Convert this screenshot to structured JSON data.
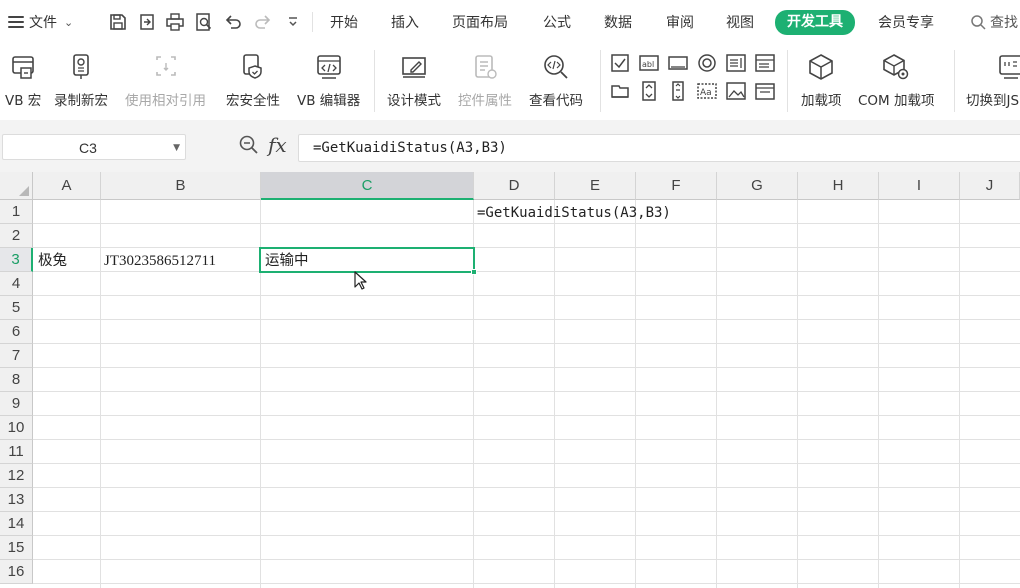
{
  "menubar": {
    "file_label": "文件",
    "tabs": [
      {
        "label": "开始",
        "active": false
      },
      {
        "label": "插入",
        "active": false
      },
      {
        "label": "页面布局",
        "active": false
      },
      {
        "label": "公式",
        "active": false
      },
      {
        "label": "数据",
        "active": false
      },
      {
        "label": "审阅",
        "active": false
      },
      {
        "label": "视图",
        "active": false
      },
      {
        "label": "开发工具",
        "active": true
      },
      {
        "label": "会员专享",
        "active": false
      }
    ],
    "search_label": "查找"
  },
  "ribbon": {
    "buttons": [
      {
        "label": "VB 宏",
        "icon": "vb-macro-icon",
        "enabled": true
      },
      {
        "label": "录制新宏",
        "icon": "record-macro-icon",
        "enabled": true
      },
      {
        "label": "使用相对引用",
        "icon": "relative-reference-icon",
        "enabled": false
      },
      {
        "label": "宏安全性",
        "icon": "macro-security-icon",
        "enabled": true
      },
      {
        "label": "VB 编辑器",
        "icon": "vb-editor-icon",
        "enabled": true
      },
      {
        "label": "设计模式",
        "icon": "design-mode-icon",
        "enabled": true
      },
      {
        "label": "控件属性",
        "icon": "control-properties-icon",
        "enabled": false
      },
      {
        "label": "查看代码",
        "icon": "view-code-icon",
        "enabled": true
      },
      {
        "label": "加载项",
        "icon": "addins-icon",
        "enabled": true
      },
      {
        "label": "COM 加载项",
        "icon": "com-addins-icon",
        "enabled": true
      },
      {
        "label": "切换到JS",
        "icon": "switch-js-icon",
        "enabled": true
      }
    ]
  },
  "formula_bar": {
    "name_box": "C3",
    "fx_label": "fx",
    "formula": "=GetKuaidiStatus(A3,B3)"
  },
  "sheet": {
    "columns": [
      "A",
      "B",
      "C",
      "D",
      "E",
      "F",
      "G",
      "H",
      "I",
      "J"
    ],
    "rows": [
      "1",
      "2",
      "3",
      "4",
      "5",
      "6",
      "7",
      "8",
      "9",
      "10",
      "11",
      "12",
      "13",
      "14",
      "15",
      "16"
    ],
    "selected_column": "C",
    "selected_row": "3",
    "cells": {
      "D1": "=GetKuaidiStatus(A3,B3)",
      "A3": "极兔",
      "B3": "JT3023586512711",
      "C3": "运输中"
    }
  }
}
